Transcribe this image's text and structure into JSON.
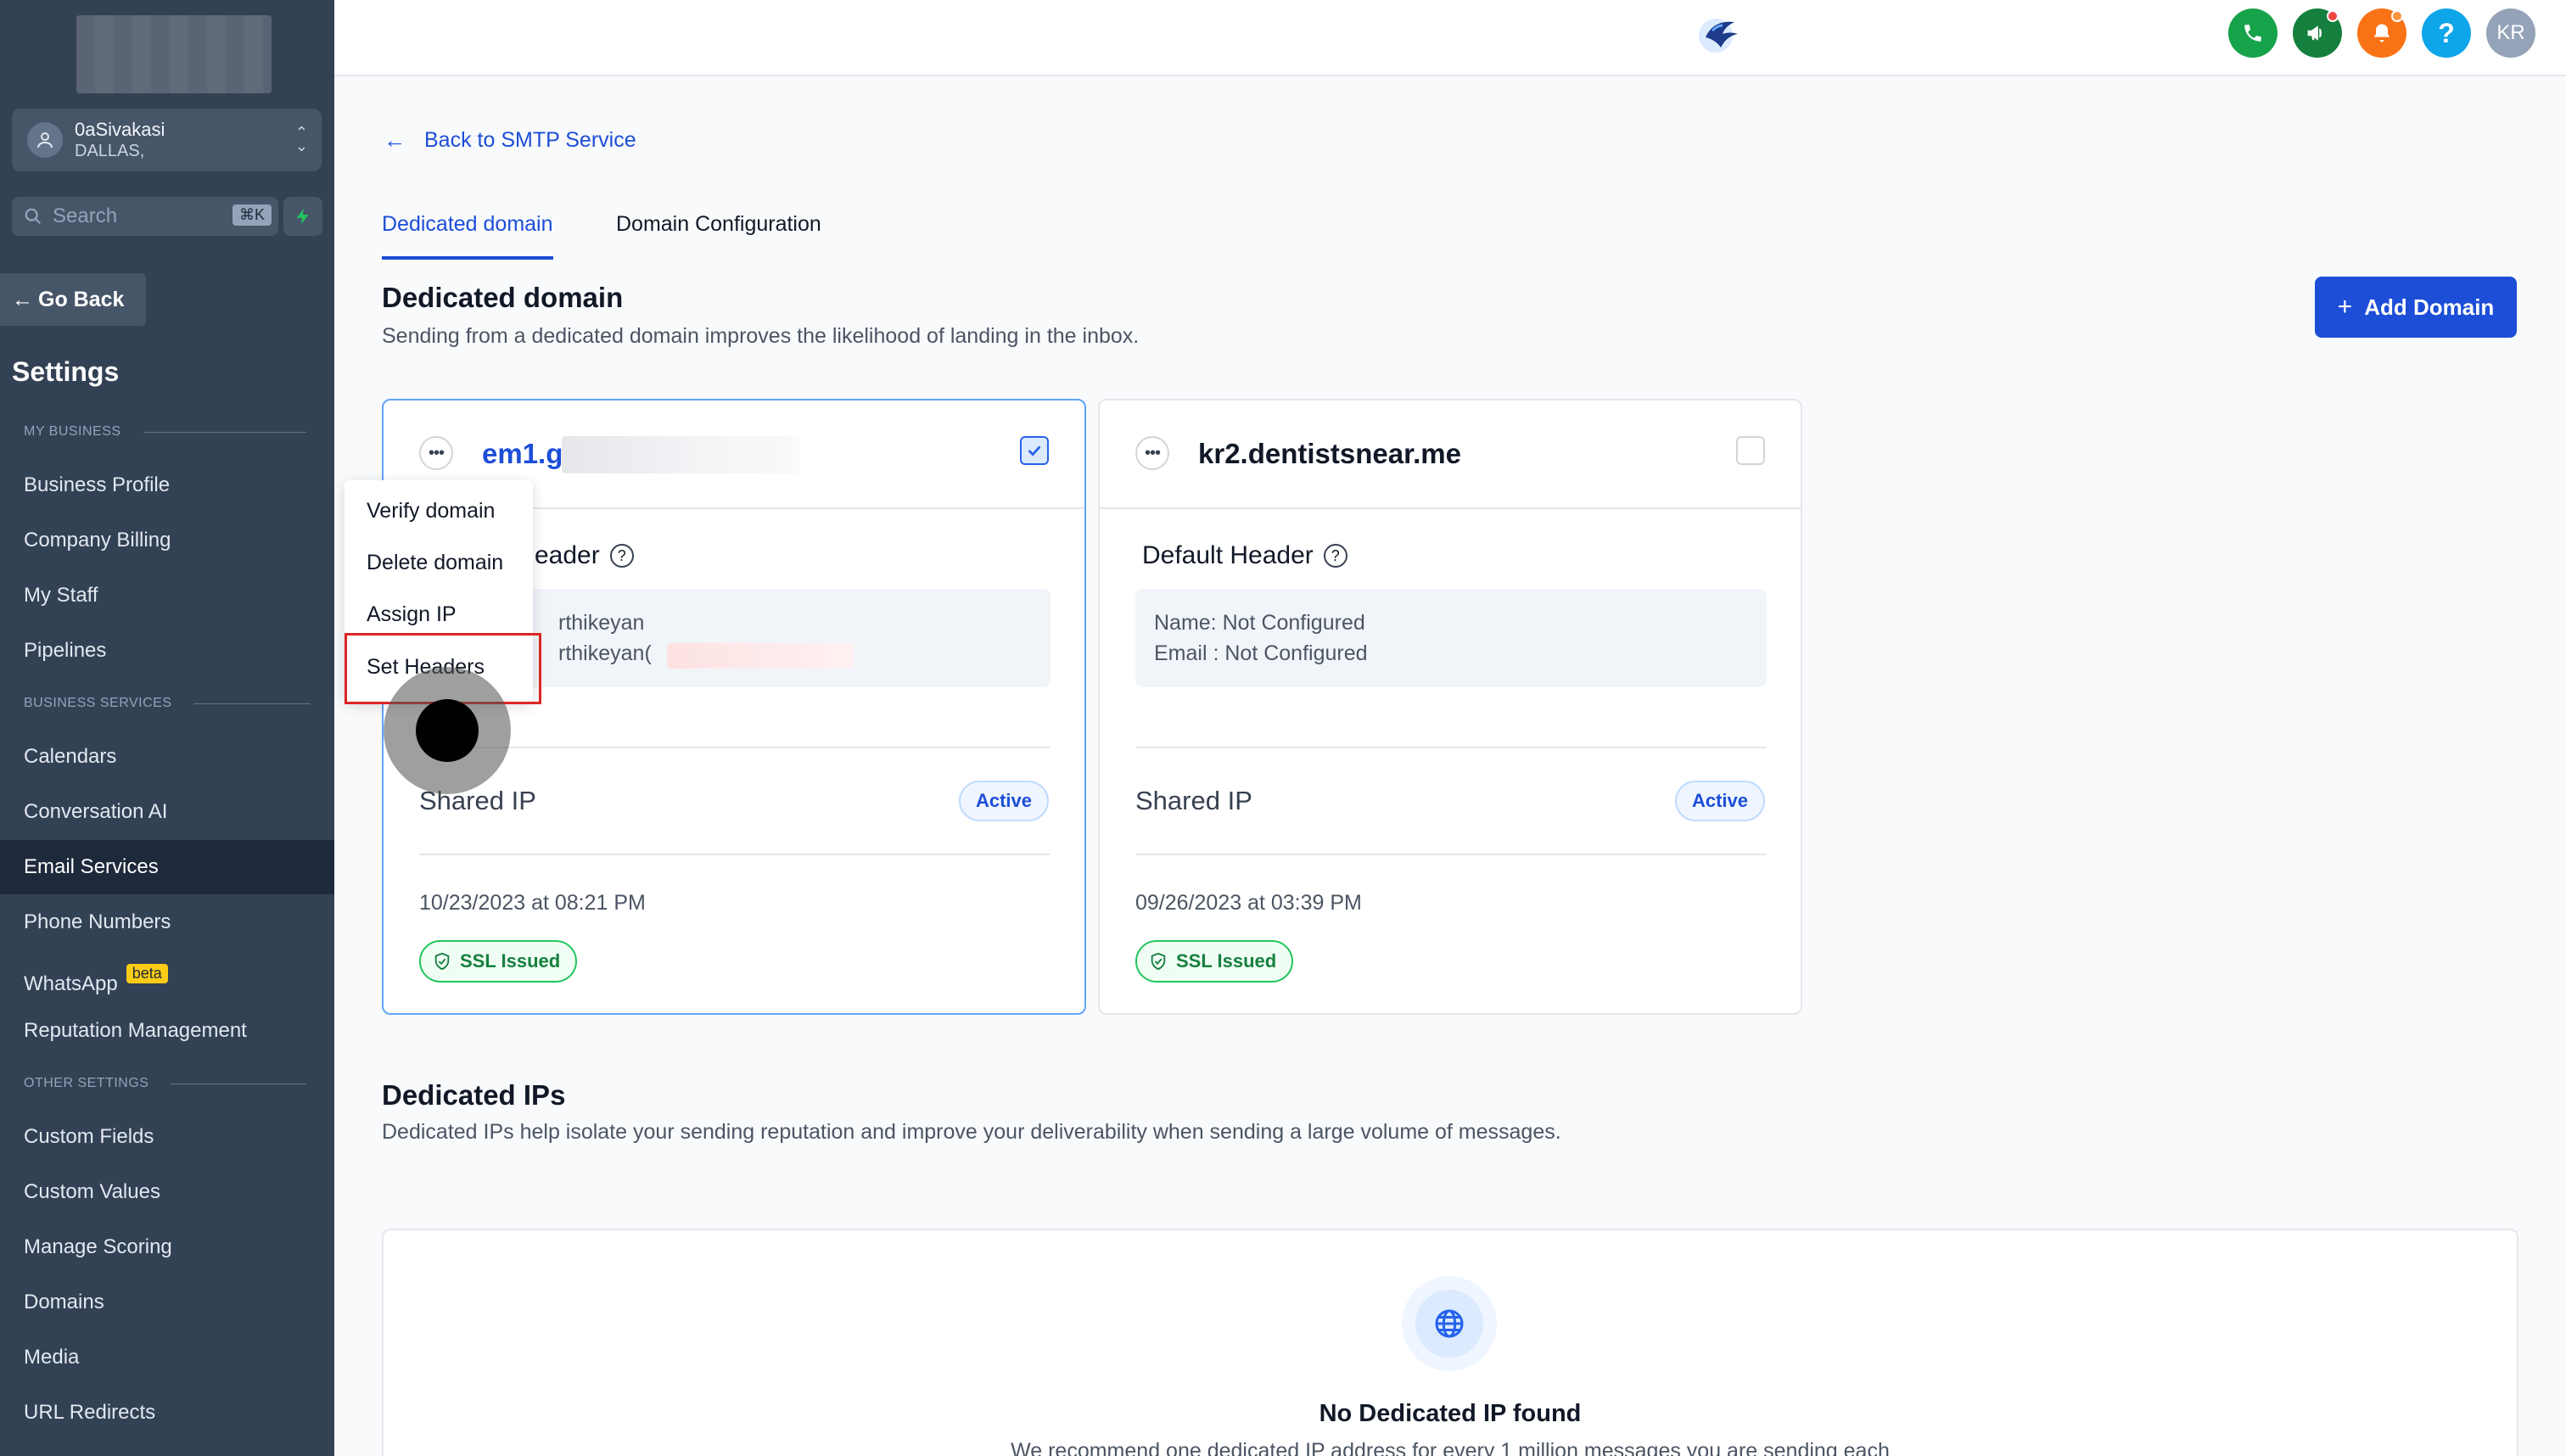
{
  "sidebar": {
    "account": {
      "name": "0aSivakasi",
      "location": "DALLAS,"
    },
    "search": {
      "placeholder": "Search",
      "shortcut": "⌘K"
    },
    "go_back": "Go Back",
    "title": "Settings",
    "sections": {
      "my_business": "MY BUSINESS",
      "business_services": "BUSINESS SERVICES",
      "other_settings": "OTHER SETTINGS"
    },
    "items": {
      "business_profile": "Business Profile",
      "company_billing": "Company Billing",
      "my_staff": "My Staff",
      "pipelines": "Pipelines",
      "calendars": "Calendars",
      "conversation_ai": "Conversation AI",
      "email_services": "Email Services",
      "phone_numbers": "Phone Numbers",
      "whatsapp": "WhatsApp",
      "whatsapp_badge": "beta",
      "reputation_management": "Reputation Management",
      "custom_fields": "Custom Fields",
      "custom_values": "Custom Values",
      "manage_scoring": "Manage Scoring",
      "domains": "Domains",
      "media": "Media",
      "url_redirects": "URL Redirects"
    }
  },
  "header": {
    "avatar_initials": "KR",
    "icons": [
      "phone-icon",
      "megaphone-icon",
      "bell-icon",
      "help-icon"
    ],
    "colors": {
      "phone": "#16a34a",
      "megaphone": "#15803d",
      "bell": "#f97316",
      "help": "#0ea5e9",
      "avatar": "#94a3b8"
    }
  },
  "main": {
    "back_link": "Back to SMTP Service",
    "tabs": [
      "Dedicated domain",
      "Domain Configuration"
    ],
    "dedicated_domain": {
      "title": "Dedicated domain",
      "subtitle": "Sending from a dedicated domain improves the likelihood of landing in the inbox.",
      "add_button": "Add Domain"
    },
    "cards": [
      {
        "domain": "em1.g",
        "checked": true,
        "header_label_partial": "eader",
        "name_line_partial": "rthikeyan",
        "email_line_partial": "rthikeyan(",
        "ip_type": "Shared IP",
        "status": "Active",
        "date": "10/23/2023 at 08:21 PM",
        "ssl": "SSL Issued"
      },
      {
        "domain": "kr2.dentistsnear.me",
        "checked": false,
        "header_label": "Default Header",
        "name_label": "Name:",
        "name_value": "Not Configured",
        "email_label": "Email :",
        "email_value": "Not Configured",
        "ip_type": "Shared IP",
        "status": "Active",
        "date": "09/26/2023 at 03:39 PM",
        "ssl": "SSL Issued"
      }
    ],
    "context_menu": [
      "Verify domain",
      "Delete domain",
      "Assign IP",
      "Set Headers"
    ],
    "dedicated_ips": {
      "title": "Dedicated IPs",
      "subtitle": "Dedicated IPs help isolate your sending reputation and improve your deliverability when sending a large volume of messages.",
      "empty_title": "No Dedicated IP found",
      "empty_subtitle": "We recommend one dedicated IP address for every 1 million messages you are sending each"
    }
  }
}
